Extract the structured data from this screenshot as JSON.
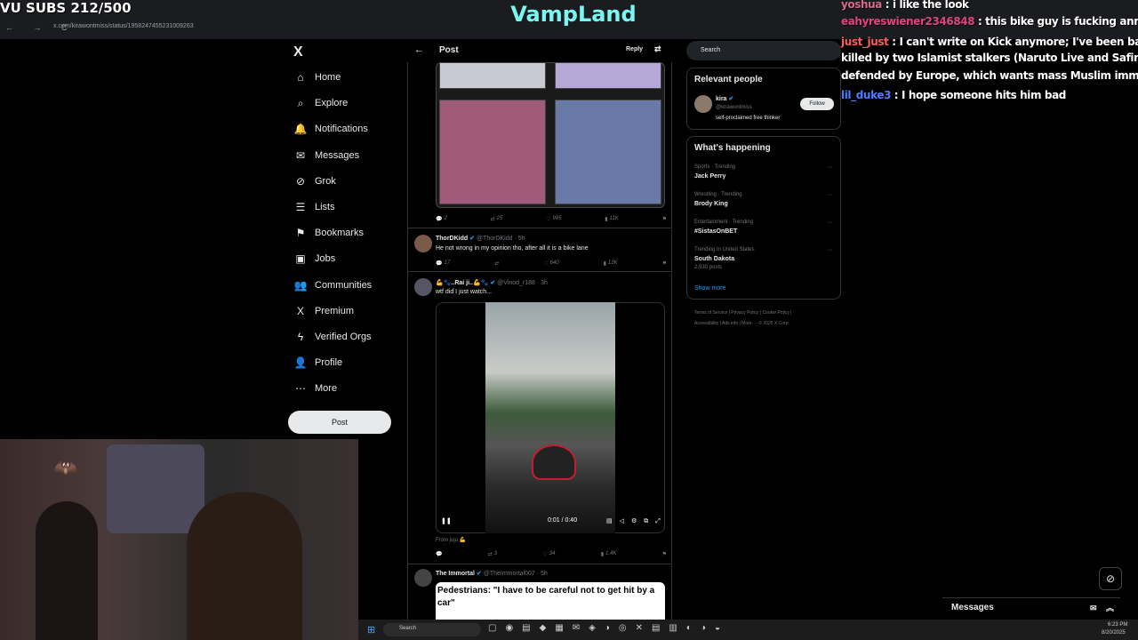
{
  "overlay": {
    "subs": "VU SUBS 212/500",
    "channel": "VampLand"
  },
  "browser": {
    "url": "x.com/kirawontmiss/status/1958247455231009263",
    "nav_icons": "← → C"
  },
  "sidebar": {
    "logo": "X",
    "items": [
      {
        "label": "Home",
        "icon": "⌂"
      },
      {
        "label": "Explore",
        "icon": "⌕"
      },
      {
        "label": "Notifications",
        "icon": "🔔"
      },
      {
        "label": "Messages",
        "icon": "✉"
      },
      {
        "label": "Grok",
        "icon": "⊘"
      },
      {
        "label": "Lists",
        "icon": "☰"
      },
      {
        "label": "Bookmarks",
        "icon": "⚑"
      },
      {
        "label": "Jobs",
        "icon": "▣"
      },
      {
        "label": "Communities",
        "icon": "👥"
      },
      {
        "label": "Premium",
        "icon": "X"
      },
      {
        "label": "Verified Orgs",
        "icon": "ϟ"
      },
      {
        "label": "Profile",
        "icon": "👤"
      },
      {
        "label": "More",
        "icon": "⋯"
      }
    ],
    "post_button": "Post"
  },
  "header": {
    "back": "←",
    "title": "Post",
    "reply": "Reply",
    "settings_icon": "⇄"
  },
  "tweets": {
    "first_actions": {
      "replies": "2",
      "reposts": "25",
      "likes": "995",
      "views": "11K"
    },
    "thor": {
      "name": "ThorDKidd",
      "handle": "@ThorDKidd · 5h",
      "text": "He not wrong in my opinion tho, after all it is a bike lane",
      "replies": "17",
      "reposts": "",
      "likes": "640",
      "views": "13K"
    },
    "vinod": {
      "name": "💪🐾..Rai ji..💪🐾",
      "handle": "@Vinod_r188 · 3h",
      "text": "wtf did I just watch...",
      "video_time": "0:01 / 0:40",
      "from": "From juju 💪",
      "replies": "",
      "reposts": "3",
      "likes": "34",
      "views": "1.4K"
    },
    "immortal": {
      "name": "The Immortal",
      "handle": "@TheImmortal007 · 5h",
      "quote": "Pedestrians: \"I have to be careful not to get hit by a car\""
    }
  },
  "right": {
    "search_placeholder": "Search",
    "relevant_title": "Relevant people",
    "person_name": "kira",
    "person_handle": "@kirawontmiss",
    "person_bio": "self-proclaimed free thinker",
    "follow": "Follow",
    "happening_title": "What's happening",
    "trends": [
      {
        "category": "Sports · Trending",
        "name": "Jack Perry",
        "posts": ""
      },
      {
        "category": "Wrestling · Trending",
        "name": "Brody King",
        "posts": ""
      },
      {
        "category": "Entertainment · Trending",
        "name": "#SistasOnBET",
        "posts": ""
      },
      {
        "category": "Trending in United States",
        "name": "South Dakota",
        "posts": "2,930 posts"
      }
    ],
    "show_more": "Show more",
    "footer1": "Terms of Service  |  Privacy Policy  |  Cookie Policy  |",
    "footer2": "Accessibility  |  Ads info  |  More ···  © 2025 X Corp."
  },
  "chat": [
    {
      "user": "yoshua",
      "color": "#d96b8a",
      "message": " : i like the look"
    },
    {
      "user": "eahyreswiener2346848",
      "color": "#e0457b",
      "message": " : this bike guy is fucking annoy"
    },
    {
      "user": "just_just",
      "color": "#ff5c5c",
      "message": " : I can't write on Kick anymore; I've been banned"
    },
    {
      "user": "",
      "color": "#fff",
      "message": "killed by two Islamist stalkers (Naruto Live and Safine), and"
    },
    {
      "user": "",
      "color": "#fff",
      "message": "defended by Europe, which wants mass Muslim immigratio"
    },
    {
      "user": "lil_duke3",
      "color": "#4f7cff",
      "message": " : I hope someone hits him bad"
    }
  ],
  "messages_bar": "Messages",
  "taskbar": {
    "search": "Search",
    "time": "6:23 PM",
    "date": "8/20/2025"
  }
}
